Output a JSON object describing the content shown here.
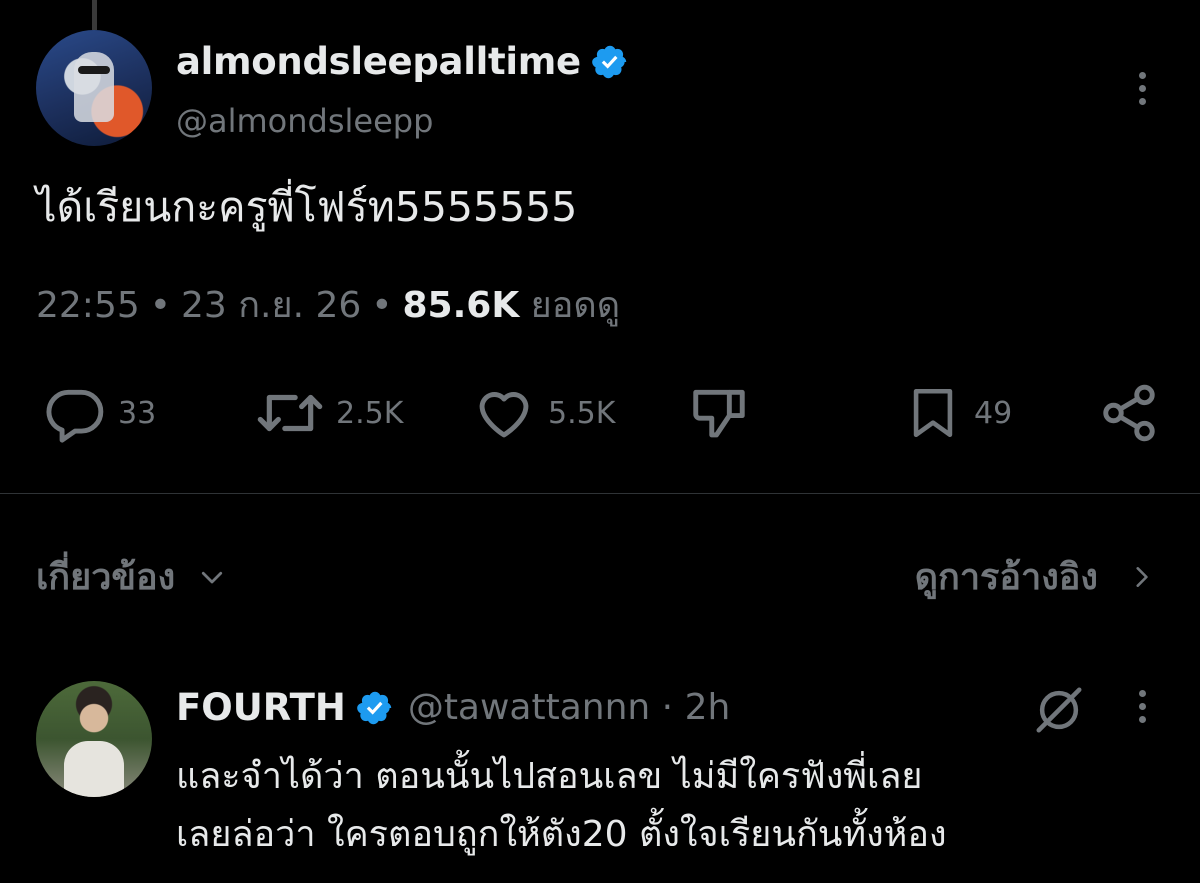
{
  "tweet": {
    "display_name": "almondsleepalltime",
    "handle": "@almondsleepp",
    "text": "ได้เรียนกะครูพี่โฟร์ท5555555",
    "time": "22:55",
    "date": "23 ก.ย. 26",
    "views_count": "85.6K",
    "views_label": "ยอดดู",
    "separator": "•"
  },
  "actions": {
    "replies": "33",
    "reposts": "2.5K",
    "likes": "5.5K",
    "bookmarks": "49"
  },
  "related": {
    "label": "เกี่ยวข้อง",
    "view_quotes": "ดูการอ้างอิง"
  },
  "reply": {
    "display_name": "FOURTH",
    "handle": "@tawattannn · 2h",
    "line1": "และจำได้ว่า ตอนนั้นไปสอนเลข ไม่มีใครฟังพี่เลย",
    "line2": "เลยล่อว่า ใครตอบถูกให้ตัง20 ตั้งใจเรียนกันทั้งห้อง"
  },
  "colors": {
    "background": "#000000",
    "text_primary": "#e7e9ea",
    "text_secondary": "#71767b",
    "verified_blue": "#1d9bf0",
    "divider": "#2f3336"
  },
  "icons": [
    "verified-badge-icon",
    "more-icon",
    "reply-icon",
    "repost-icon",
    "like-icon",
    "dislike-icon",
    "bookmark-icon",
    "share-icon",
    "chevron-down-icon",
    "chevron-right-icon",
    "grok-icon"
  ]
}
